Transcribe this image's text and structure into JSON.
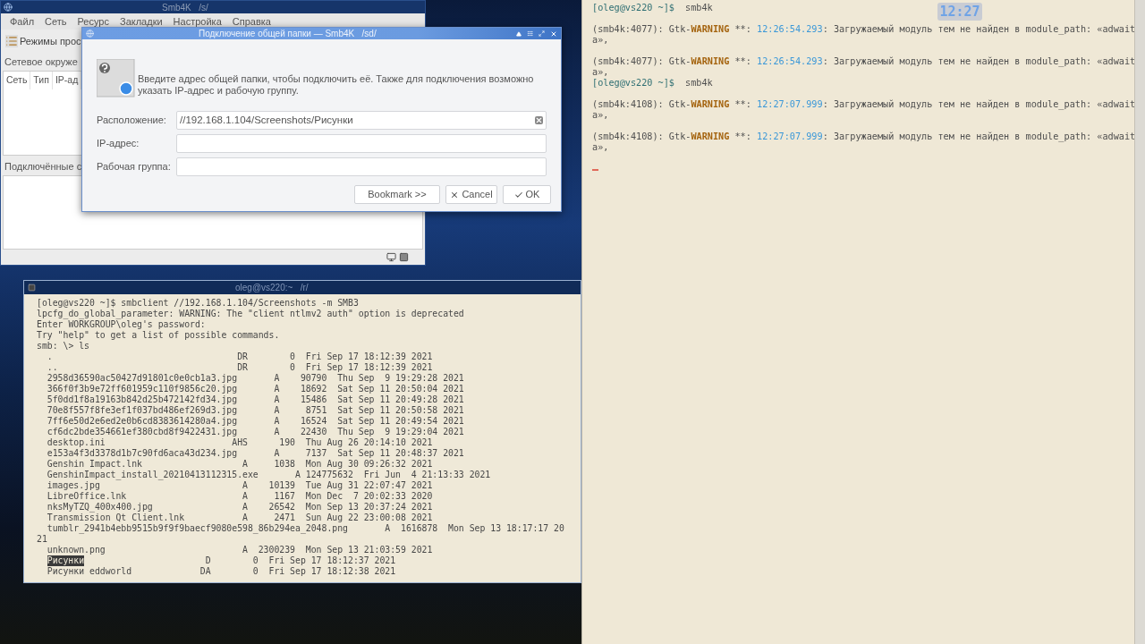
{
  "main_window": {
    "title": "Smb4K   /s/",
    "menu": [
      "Файл",
      "Сеть",
      "Ресурс",
      "Закладки",
      "Настройка",
      "Справка"
    ],
    "toolbar_button": "Режимы прос",
    "network_section": "Сетевое окруже",
    "columns": [
      "Сеть",
      "Тип",
      "IP-ад"
    ],
    "mounted_section": "Подключённые с"
  },
  "dialog": {
    "title": "Подключение общей папки — Smb4K   /sd/",
    "description": "Введите адрес общей папки, чтобы подключить её. Также для подключения возможно указать IP-адрес и рабочую группу.",
    "fields": [
      {
        "label": "Расположение:",
        "value": "//192.168.1.104/Screenshots/Рисунки"
      },
      {
        "label": "IP-адрес:"
      },
      {
        "label": "Рабочая группа:"
      }
    ],
    "buttons": [
      {
        "label": "Bookmark >>",
        "kind": "bookmark"
      },
      {
        "label": "Cancel",
        "kind": "cancel"
      },
      {
        "label": "OK",
        "kind": "ok"
      }
    ]
  },
  "terminal": {
    "title": "oleg@vs220:~   /r/",
    "lines": [
      "[oleg@vs220 ~]$ smbclient //192.168.1.104/Screenshots -m SMB3",
      "lpcfg_do_global_parameter: WARNING: The \"client ntlmv2 auth\" option is deprecated",
      "Enter WORKGROUP\\oleg's password:",
      "Try \"help\" to get a list of possible commands.",
      "smb: \\> ls",
      "  .                                   DR        0  Fri Sep 17 18:12:39 2021",
      "  ..                                  DR        0  Fri Sep 17 18:12:39 2021",
      "  2958d36590ac50427d91801c0e0cb1a3.jpg       A    90790  Thu Sep  9 19:29:28 2021",
      "  366f0f3b9e72ff601959c110f9856c20.jpg       A    18692  Sat Sep 11 20:50:04 2021",
      "  5f0dd1f8a19163b842d25b472142fd34.jpg       A    15486  Sat Sep 11 20:49:28 2021",
      "  70e8f557f8fe3ef1f037bd486ef269d3.jpg       A     8751  Sat Sep 11 20:50:58 2021",
      "  7ff6e50d2e6ed2e0b6cd8383614280a4.jpg       A    16524  Sat Sep 11 20:49:54 2021",
      "  cf6dc2bde354661ef380cbd8f9422431.jpg       A    22430  Thu Sep  9 19:29:04 2021",
      "  desktop.ini                        AHS      190  Thu Aug 26 20:14:10 2021",
      "  e153a4f3d3378d1b7c90fd6aca43d234.jpg       A     7137  Sat Sep 11 20:48:37 2021",
      "  Genshin Impact.lnk                   A     1038  Mon Aug 30 09:26:32 2021",
      "  GenshinImpact_install_20210413112315.exe       A 124775632  Fri Jun  4 21:13:33 2021",
      "  images.jpg                           A    10139  Tue Aug 31 22:07:47 2021",
      "  LibreOffice.lnk                      A     1167  Mon Dec  7 20:02:33 2020",
      "  nksMyTZQ_400x400.jpg                 A    26542  Mon Sep 13 20:37:24 2021",
      "  Transmission Qt Client.lnk           A     2471  Sun Aug 22 23:00:08 2021",
      "  tumblr_2941b4ebb9515b9f9f9baecf9080e598_86b294ea_2048.png       A  1616878  Mon Sep 13 18:17:17 20",
      "21",
      "  unknown.png                          A  2300239  Mon Sep 13 21:03:59 2021",
      {
        "kind": "selection",
        "selected_text": "Рисунки",
        "rest": "                       D        0  Fri Sep 17 18:12:37 2021"
      },
      "  Рисунки eddworld             DA        0  Fri Sep 17 18:12:38 2021"
    ]
  },
  "console": {
    "lines": [
      {
        "kind": "prompt",
        "prompt": "[oleg@vs220 ~]$",
        "command": "smb4k"
      },
      {
        "kind": "message",
        "origin": "(smb4k:4077): Gtk-",
        "severity": "WARNING",
        "separator": " **: ",
        "time": "12:26:54.293",
        "text": ": Загружаемый модуль тем не найден в module_path: «adwait"
      },
      {
        "kind": "wrap",
        "text": "a»,"
      },
      {
        "kind": "message",
        "origin": "(smb4k:4077): Gtk-",
        "severity": "WARNING",
        "separator": " **: ",
        "time": "12:26:54.293",
        "text": ": Загружаемый модуль тем не найден в module_path: «adwait"
      },
      {
        "kind": "wrap",
        "text": "a»,"
      },
      {
        "kind": "prompt",
        "prompt": "[oleg@vs220 ~]$",
        "command": "smb4k"
      },
      {
        "kind": "message",
        "origin": "(smb4k:4108): Gtk-",
        "severity": "WARNING",
        "separator": " **: ",
        "time": "12:27:07.999",
        "text": ": Загружаемый модуль тем не найден в module_path: «adwait"
      },
      {
        "kind": "wrap",
        "text": "a»,"
      },
      {
        "kind": "message",
        "origin": "(smb4k:4108): Gtk-",
        "severity": "WARNING",
        "separator": " **: ",
        "time": "12:27:07.999",
        "text": ": Загружаемый модуль тем не найден в module_path: «adwait"
      },
      {
        "kind": "wrap",
        "text": "a»,"
      },
      {
        "kind": "cursor"
      }
    ]
  },
  "clock": "12:27"
}
